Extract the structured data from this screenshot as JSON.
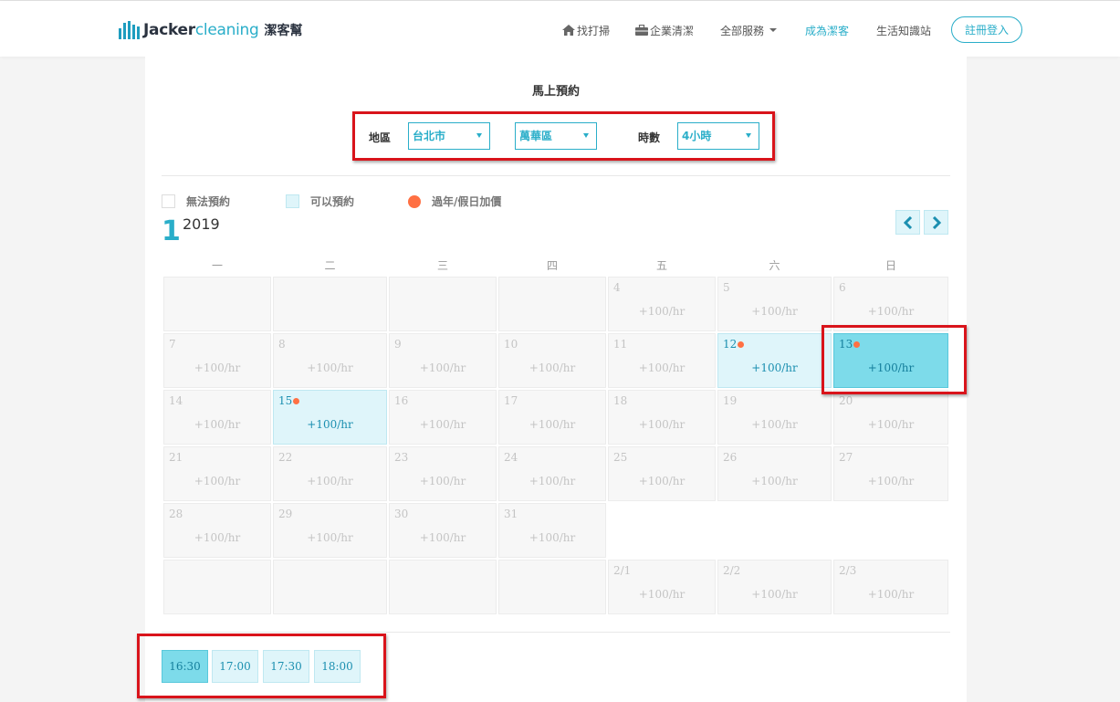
{
  "brand": {
    "logo_primary": "Jacker",
    "logo_secondary": "cleaning",
    "logo_chinese": "潔客幫",
    "accent_color": "#2aaec9"
  },
  "nav": {
    "items": [
      {
        "label": "找打掃",
        "icon": "home-icon"
      },
      {
        "label": "企業清潔",
        "icon": "briefcase-icon"
      },
      {
        "label": "全部服務",
        "icon": "chevron-down-icon"
      },
      {
        "label": "成為潔客",
        "active": true
      },
      {
        "label": "生活知識站"
      }
    ],
    "login_label": "註冊登入"
  },
  "booking": {
    "title": "馬上預約",
    "region_label": "地區",
    "city_value": "台北市",
    "district_value": "萬華區",
    "hours_label": "時數",
    "hours_value": "4小時"
  },
  "legend": {
    "unavailable": "無法預約",
    "available": "可以預約",
    "surcharge": "過年/假日加價",
    "surcharge_color": "#ff7043"
  },
  "calendar": {
    "month": "1",
    "year": "2019",
    "weekdays": [
      "一",
      "二",
      "三",
      "四",
      "五",
      "六",
      "日"
    ],
    "rows": [
      [
        {
          "day": "",
          "price": ""
        },
        {
          "day": "",
          "price": ""
        },
        {
          "day": "",
          "price": ""
        },
        {
          "day": "",
          "price": ""
        },
        {
          "day": "4",
          "price": "+100/hr"
        },
        {
          "day": "5",
          "price": "+100/hr"
        },
        {
          "day": "6",
          "price": "+100/hr"
        }
      ],
      [
        {
          "day": "7",
          "price": "+100/hr"
        },
        {
          "day": "8",
          "price": "+100/hr"
        },
        {
          "day": "9",
          "price": "+100/hr"
        },
        {
          "day": "10",
          "price": "+100/hr"
        },
        {
          "day": "11",
          "price": "+100/hr"
        },
        {
          "day": "12",
          "price": "+100/hr",
          "state": "available",
          "surcharge": true
        },
        {
          "day": "13",
          "price": "+100/hr",
          "state": "selected",
          "surcharge": true
        }
      ],
      [
        {
          "day": "14",
          "price": "+100/hr"
        },
        {
          "day": "15",
          "price": "+100/hr",
          "state": "available",
          "surcharge": true
        },
        {
          "day": "16",
          "price": "+100/hr"
        },
        {
          "day": "17",
          "price": "+100/hr"
        },
        {
          "day": "18",
          "price": "+100/hr"
        },
        {
          "day": "19",
          "price": "+100/hr"
        },
        {
          "day": "20",
          "price": "+100/hr"
        }
      ],
      [
        {
          "day": "21",
          "price": "+100/hr"
        },
        {
          "day": "22",
          "price": "+100/hr"
        },
        {
          "day": "23",
          "price": "+100/hr"
        },
        {
          "day": "24",
          "price": "+100/hr"
        },
        {
          "day": "25",
          "price": "+100/hr"
        },
        {
          "day": "26",
          "price": "+100/hr"
        },
        {
          "day": "27",
          "price": "+100/hr"
        }
      ],
      [
        {
          "day": "28",
          "price": "+100/hr"
        },
        {
          "day": "29",
          "price": "+100/hr"
        },
        {
          "day": "30",
          "price": "+100/hr"
        },
        {
          "day": "31",
          "price": "+100/hr"
        }
      ],
      [
        {
          "day": "",
          "price": ""
        },
        {
          "day": "",
          "price": ""
        },
        {
          "day": "",
          "price": ""
        },
        {
          "day": "",
          "price": ""
        },
        {
          "day": "2/1",
          "price": "+100/hr"
        },
        {
          "day": "2/2",
          "price": "+100/hr"
        },
        {
          "day": "2/3",
          "price": "+100/hr"
        }
      ]
    ]
  },
  "time_slots": [
    {
      "label": "16:30",
      "selected": true
    },
    {
      "label": "17:00"
    },
    {
      "label": "17:30"
    },
    {
      "label": "18:00"
    }
  ]
}
